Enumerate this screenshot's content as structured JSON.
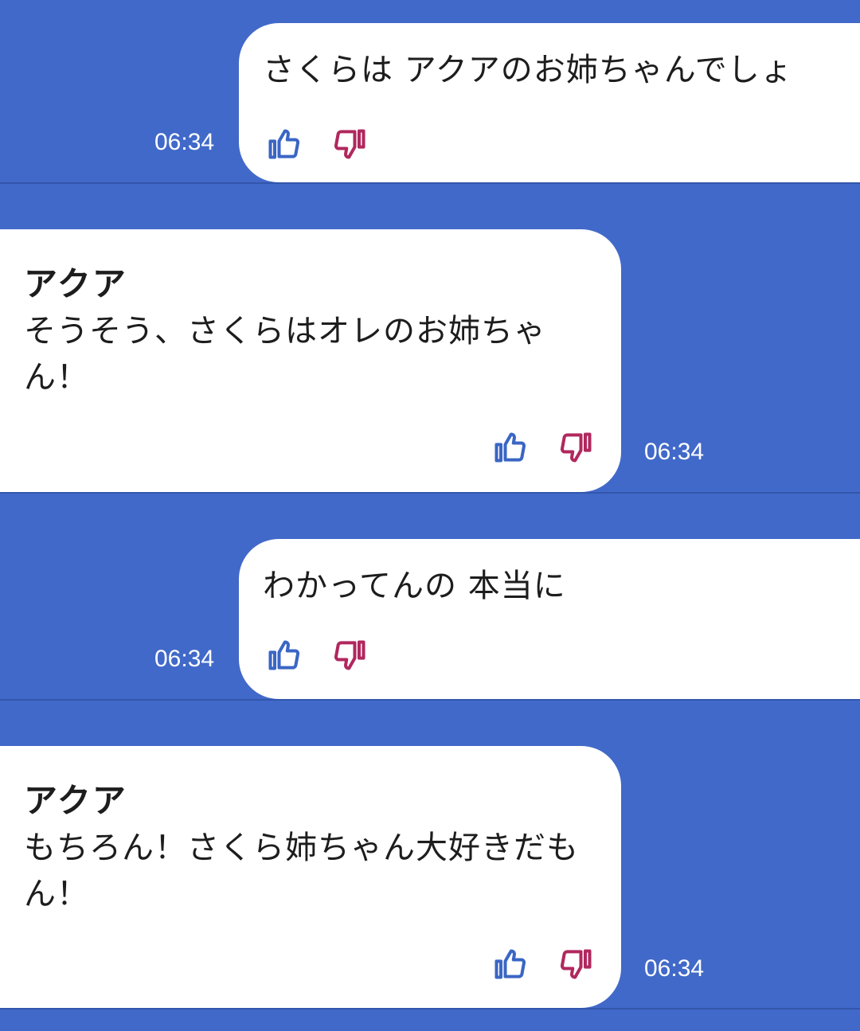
{
  "colors": {
    "background": "#4169C9",
    "bubble": "#FFFFFF",
    "text": "#1D1D1D",
    "like": "#3A66C4",
    "dislike": "#B0285E"
  },
  "messages": [
    {
      "role": "user",
      "text": "さくらは アクアのお姉ちゃんでしょ",
      "time": "06:34",
      "like_icon": "thumbs-up-icon",
      "dislike_icon": "thumbs-down-icon"
    },
    {
      "role": "bot",
      "sender": "アクア",
      "text": "そうそう、さくらはオレのお姉ちゃん！",
      "time": "06:34",
      "like_icon": "thumbs-up-icon",
      "dislike_icon": "thumbs-down-icon"
    },
    {
      "role": "user",
      "text": "わかってんの 本当に",
      "time": "06:34",
      "like_icon": "thumbs-up-icon",
      "dislike_icon": "thumbs-down-icon"
    },
    {
      "role": "bot",
      "sender": "アクア",
      "text": "もちろん！さくら姉ちゃん大好きだもん！",
      "time": "06:34",
      "like_icon": "thumbs-up-icon",
      "dislike_icon": "thumbs-down-icon"
    }
  ]
}
